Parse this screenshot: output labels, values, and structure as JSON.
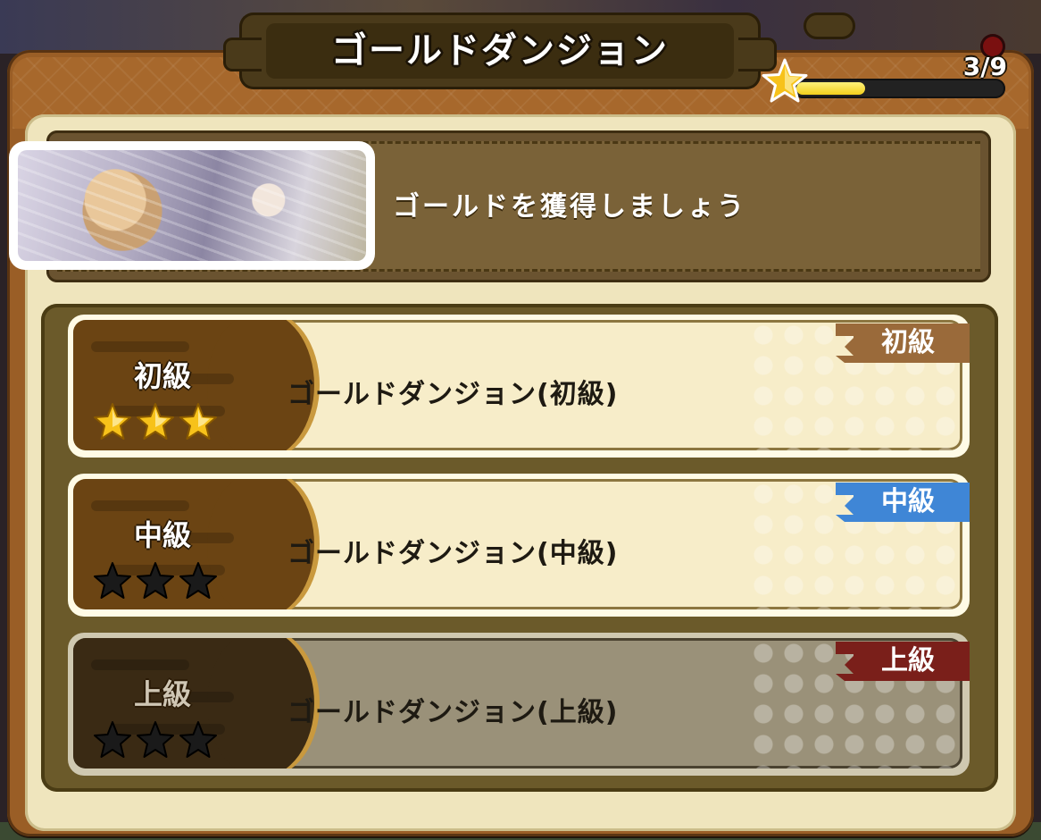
{
  "header": {
    "title": "ゴールドダンジョン"
  },
  "progress": {
    "count_label": "3/9",
    "fraction": 0.333
  },
  "banner": {
    "message": "ゴールドを獲得しましょう"
  },
  "dungeons": [
    {
      "rank": "初級",
      "name": "ゴールドダンジョン(初級)",
      "tag": "初級",
      "tag_color": "#9a6a3a",
      "stars_earned": 3,
      "stars_total": 3,
      "locked": false
    },
    {
      "rank": "中級",
      "name": "ゴールドダンジョン(中級)",
      "tag": "中級",
      "tag_color": "#3f86d6",
      "stars_earned": 0,
      "stars_total": 3,
      "locked": false
    },
    {
      "rank": "上級",
      "name": "ゴールドダンジョン(上級)",
      "tag": "上級",
      "tag_color": "#7a1f1a",
      "stars_earned": 0,
      "stars_total": 3,
      "locked": true
    }
  ],
  "colors": {
    "star_gold": "#f7c21a",
    "star_empty": "#1a1a1a",
    "progress_fill": "#f3cf1c"
  },
  "icons": {
    "progress_star": "star-icon",
    "rank_star": "star-icon"
  }
}
